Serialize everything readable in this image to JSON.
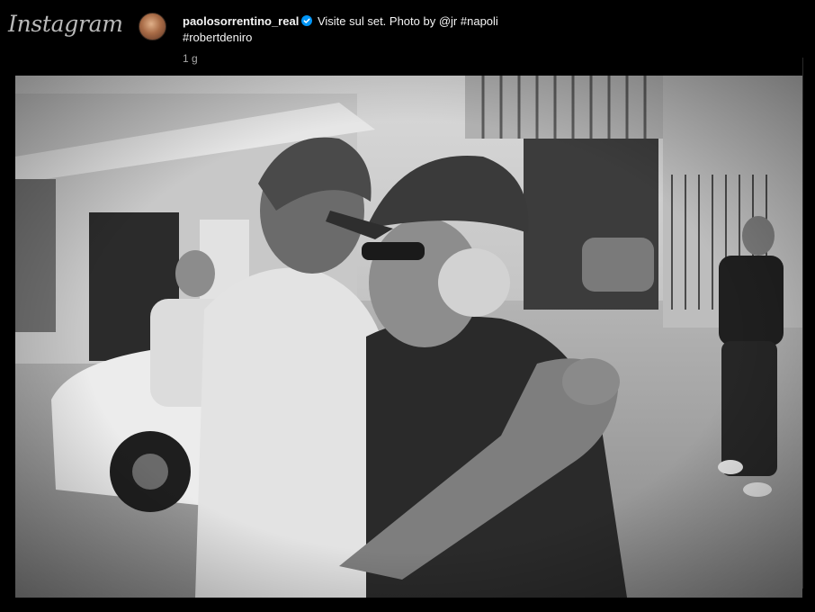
{
  "header": {
    "logo_text": "Instagram"
  },
  "post": {
    "author": {
      "username": "paolosorrentino_real",
      "avatar_icon": "profile-avatar-icon",
      "verified_icon": "verified-badge-icon",
      "verified_color": "#0095f6"
    },
    "caption": {
      "text": "Visite sul set. Photo by",
      "mention": "@jr",
      "hashtag_1": "#napoli",
      "hashtag_2": "#robertdeniro"
    },
    "timestamp": "1 g",
    "photo": {
      "style": "black-and-white"
    }
  },
  "colors": {
    "background": "#000000",
    "text_primary": "#f5f5f5",
    "text_secondary": "#a8a8a8",
    "logo": "#b9b9b9"
  }
}
